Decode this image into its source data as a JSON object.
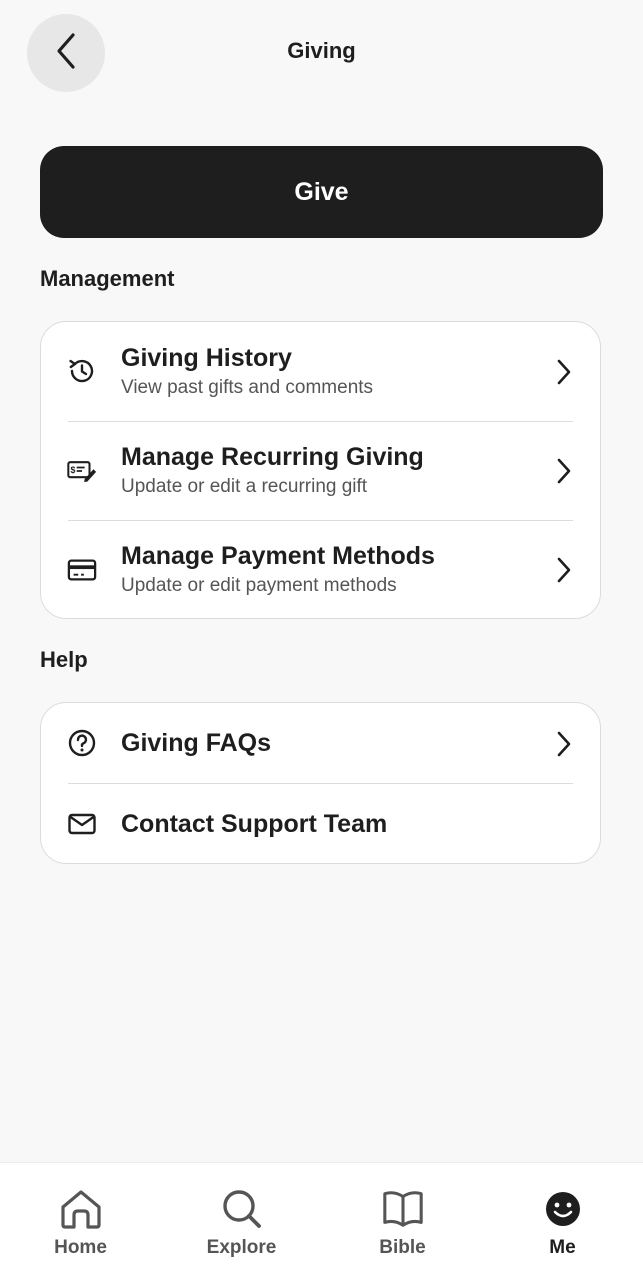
{
  "header": {
    "title": "Giving"
  },
  "give_button": {
    "label": "Give"
  },
  "management": {
    "heading": "Management",
    "items": [
      {
        "title": "Giving History",
        "subtitle": "View past gifts and comments",
        "icon": "history-icon"
      },
      {
        "title": "Manage Recurring Giving",
        "subtitle": "Update or edit a recurring gift",
        "icon": "check-edit-icon"
      },
      {
        "title": "Manage Payment Methods",
        "subtitle": "Update or edit payment methods",
        "icon": "credit-card-icon"
      }
    ]
  },
  "help": {
    "heading": "Help",
    "items": [
      {
        "title": "Giving FAQs",
        "icon": "question-circle-icon"
      },
      {
        "title": "Contact Support Team",
        "icon": "mail-icon"
      }
    ]
  },
  "tabbar": {
    "tabs": [
      {
        "label": "Home",
        "icon": "home-icon"
      },
      {
        "label": "Explore",
        "icon": "search-icon"
      },
      {
        "label": "Bible",
        "icon": "book-icon"
      },
      {
        "label": "Me",
        "icon": "smiley-icon",
        "active": true
      }
    ]
  },
  "colors": {
    "primary_button": "#1e1e1e",
    "background": "#f8f8f8",
    "card": "#ffffff"
  }
}
